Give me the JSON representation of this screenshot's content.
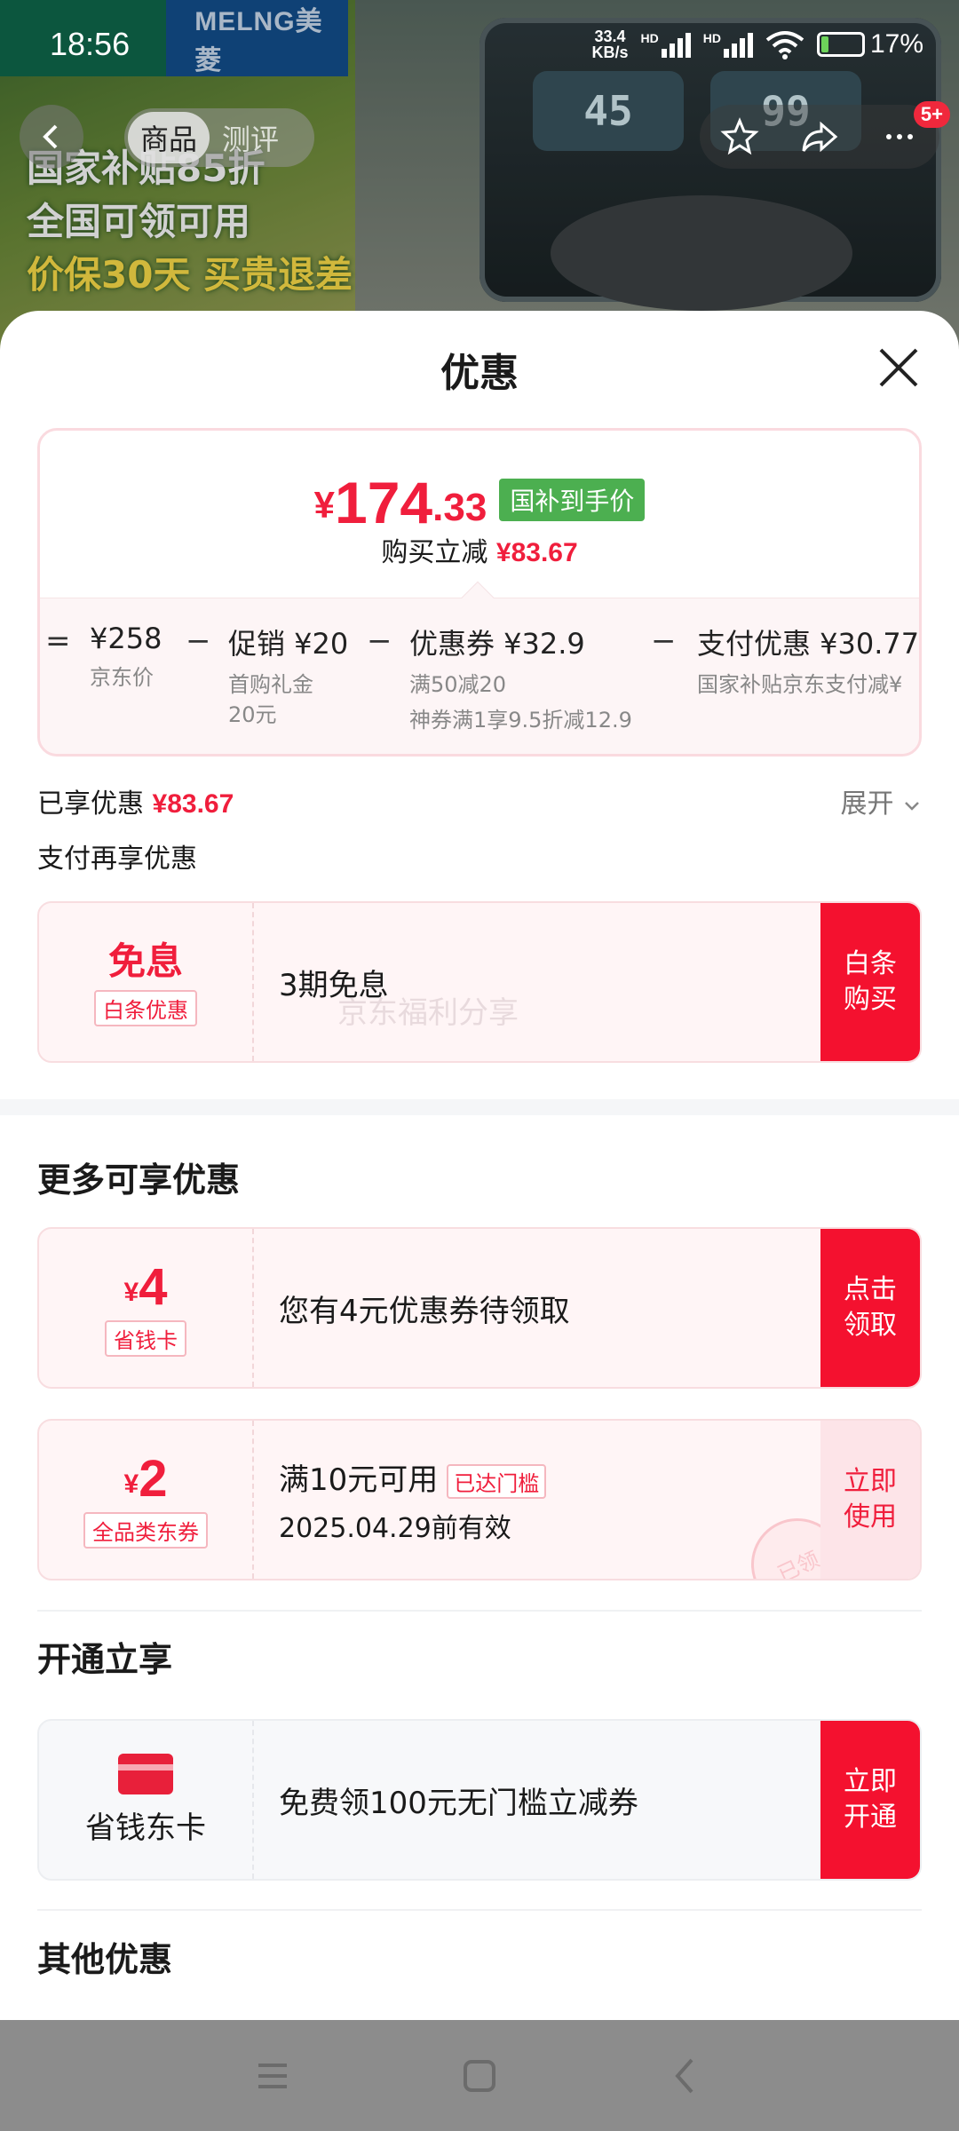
{
  "status_bar": {
    "time": "18:56",
    "net_speed": "33.4",
    "net_unit": "KB/s",
    "hd1": "HD",
    "hd2": "HD",
    "battery": "17%"
  },
  "background": {
    "logo_text": "MELNG美菱",
    "promo_lines": [
      "国家补贴85折",
      "全国可领可用",
      "价保30天 买贵退差"
    ],
    "device_display_1": "45",
    "device_display_2": "99"
  },
  "product_header": {
    "tabs": [
      "商品",
      "测评"
    ],
    "badge": "5+"
  },
  "sheet": {
    "title": "优惠",
    "price_card": {
      "currency": "¥",
      "final_price_int": "174",
      "final_price_dec": ".33",
      "tag": "国补到手价",
      "instant_label": "购买立减",
      "instant_value": "¥83.67",
      "breakdown": [
        {
          "op": "=",
          "value": "¥258",
          "desc": [
            "京东价"
          ]
        },
        {
          "op": "−",
          "value": "促销 ¥20",
          "desc": [
            "首购礼金",
            "20元"
          ]
        },
        {
          "op": "−",
          "value": "优惠券 ¥32.9",
          "desc": [
            "满50减20",
            "神券满1享9.5折减12.9"
          ]
        },
        {
          "op": "−",
          "value": "支付优惠 ¥30.77",
          "desc": [
            "国家补贴京东支付减¥"
          ]
        }
      ]
    },
    "enjoyed_label": "已享优惠",
    "enjoyed_value": "¥83.67",
    "expand_label": "展开",
    "pay_again_label": "支付再享优惠",
    "baitiao": {
      "big": "免息",
      "tag": "白条优惠",
      "text": "3期免息",
      "button": "白条购买"
    },
    "watermark": "京东福利分享",
    "more_title": "更多可享优惠",
    "saver_card": {
      "currency": "¥",
      "amount": "4",
      "tag": "省钱卡",
      "text": "您有4元优惠券待领取",
      "button": "点击领取"
    },
    "all_coupon": {
      "currency": "¥",
      "amount": "2",
      "tag": "全品类东券",
      "line1": "满10元可用",
      "reach_tag": "已达门槛",
      "line2": "2025.04.29前有效",
      "button": "立即使用",
      "stamp": "已领"
    },
    "open_title": "开通立享",
    "jd_card": {
      "name": "省钱东卡",
      "text": "免费领100元无门槛立减券",
      "button": "立即开通"
    },
    "other_title": "其他优惠"
  },
  "colors": {
    "accent_red": "#f01e3c",
    "button_red": "#f4112f",
    "green_tag": "#4caf50"
  }
}
